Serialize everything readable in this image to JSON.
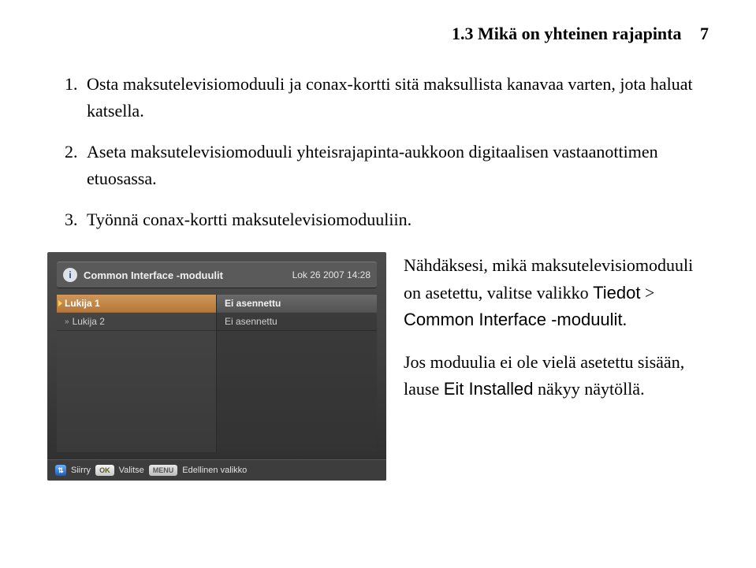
{
  "header": {
    "section_num": "1.3",
    "section_title": "Mikä on yhteinen rajapinta",
    "page_num": "7"
  },
  "steps": [
    "Osta maksutelevisiomoduuli ja conax-kortti sitä maksullista kanavaa varten, jota haluat katsella.",
    "Aseta maksutelevisiomoduuli yhteisrajapinta-aukkoon digitaalisen vastaanottimen etuosassa.",
    "Työnnä conax-kortti maksutelevisiomoduuliin."
  ],
  "screenshot": {
    "title": "Common Interface -moduulit",
    "datetime": "Lok 26 2007 14:28",
    "left_col": {
      "items": [
        {
          "label": "Lukija 1",
          "selected": true
        },
        {
          "label": "Lukija 2",
          "selected": false
        }
      ]
    },
    "right_col": {
      "items": [
        {
          "label": "Ei asennettu",
          "selected": true
        },
        {
          "label": "Ei asennettu",
          "selected": false
        }
      ]
    },
    "footer": {
      "move_label": "Siirry",
      "ok_key": "OK",
      "select_label": "Valitse",
      "menu_key": "MENU",
      "prev_label": "Edellinen valikko"
    }
  },
  "side": {
    "p1_a": "Nähdäksesi, mikä maksutelevisiomoduuli on asetettu, valitse valikko ",
    "p1_menu1": "Tiedot",
    "p1_gt": " > ",
    "p1_menu2": "Common Interface -moduulit",
    "p1_end": ".",
    "p2_a": "Jos moduulia ei ole vielä asetettu sisään, lause ",
    "p2_lbl": "Eit Installed",
    "p2_b": " näkyy näytöllä."
  }
}
